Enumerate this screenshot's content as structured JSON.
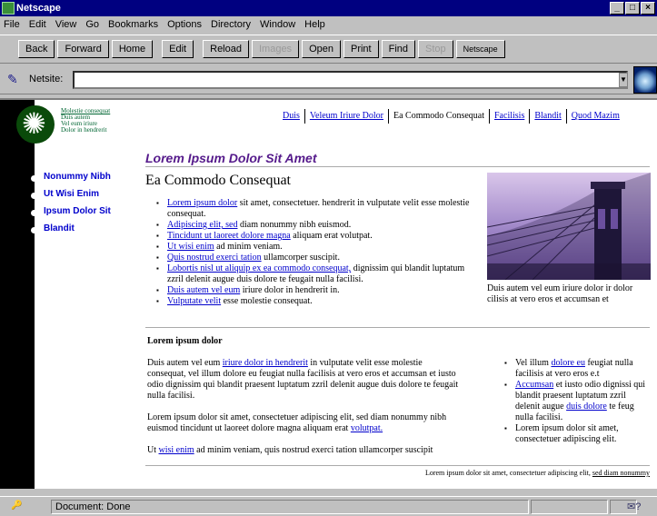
{
  "window": {
    "title": "Netscape"
  },
  "menu": [
    "File",
    "Edit",
    "View",
    "Go",
    "Bookmarks",
    "Options",
    "Directory",
    "Window",
    "Help"
  ],
  "toolbar": {
    "buttons": [
      "Back",
      "Forward",
      "Home",
      "Edit",
      "Reload",
      "Images",
      "Open",
      "Print",
      "Find",
      "Stop",
      "Netscape"
    ],
    "disabled": [
      "Images",
      "Stop"
    ]
  },
  "location": {
    "label": "Netsite:",
    "value": ""
  },
  "page": {
    "brand_lines": [
      "Molestie consequat",
      "Duis autem",
      "Vel eum iriure",
      "Dolor in hendrerit"
    ],
    "topnav": [
      {
        "label": "Duis",
        "current": false
      },
      {
        "label": "Veleum Iriure Dolor",
        "current": false
      },
      {
        "label": "Ea Commodo Consequat",
        "current": true
      },
      {
        "label": "Facilisis",
        "current": false
      },
      {
        "label": "Blandit",
        "current": false
      },
      {
        "label": "Quod Mazim",
        "current": false
      }
    ],
    "headline": "Lorem Ipsum Dolor Sit Amet",
    "sidenav": [
      "Nonummy Nibh",
      "Ut Wisi Enim",
      "Ipsum Dolor Sit",
      "Blandit"
    ],
    "section_title": "Ea Commodo Consequat",
    "bullets": [
      {
        "link": "Lorem ipsum dolor",
        "text": " sit amet, consectetuer. hendrerit in vulputate velit esse molestie consequat."
      },
      {
        "link": "Adipiscing elit, sed",
        "text": " diam nonummy nibh euismod."
      },
      {
        "link": "Tincidunt ut laoreet dolore magna",
        "text": " aliquam erat volutpat."
      },
      {
        "link": "Ut wisi enim",
        "text": " ad minim veniam."
      },
      {
        "link": "Quis nostrud exerci tation",
        "text": " ullamcorper suscipit."
      },
      {
        "link": "Lobortis nisl ut aliquip ex ea commodo consequat,",
        "text": " dignissim qui blandit luptatum zzril delenit augue duis dolore te feugait nulla facilisi."
      },
      {
        "link": "Duis autem vel eum",
        "text": " iriure dolor in hendrerit in."
      },
      {
        "link": "Vulputate velit",
        "text": " esse molestie consequat."
      }
    ],
    "photo_caption": "Duis autem vel eum iriure dolor ir dolor cilisis at vero eros et accumsan et",
    "subheading": "Lorem ipsum dolor",
    "para1": {
      "a": "Duis autem vel eum ",
      "link": "iriure dolor in hendrerit",
      "b": " in vulputate velit esse molestie consequat, vel illum dolore eu feugiat nulla facilisis at vero eros et accumsan et iusto odio dignissim qui blandit praesent luptatum zzril delenit augue duis dolore te feugait nulla facilisi."
    },
    "para2": {
      "a": "Lorem ipsum dolor sit amet, consectetuer adipiscing elit, sed diam nonummy nibh euismod tincidunt ut laoreet dolore magna aliquam erat ",
      "link": "volutpat.",
      "b": ""
    },
    "para3": {
      "a": "Ut ",
      "link": "wisi enim",
      "b": " ad minim veniam, quis nostrud exerci tation ullamcorper suscipit"
    },
    "rightlist": [
      {
        "a": "Vel illum ",
        "link": "dolore eu",
        "b": " feugiat nulla facilisis at vero eros e.t"
      },
      {
        "a": "",
        "link": "Accumsan",
        "b": " et iusto odio dignissi qui blandit praesent luptatum zzril delenit augue ",
        "link2": "duis dolore",
        "c": " te feug nulla facilisi."
      },
      {
        "a": "Lorem ipsum dolor sit amet, consectetuer adipiscing elit.",
        "link": "",
        "b": ""
      }
    ],
    "footer": {
      "text": "Lorem ipsum dolor sit amet, consectetuer adipiscing elit, ",
      "link": "sed diam nonummy"
    }
  },
  "status": {
    "text": "Document: Done"
  }
}
